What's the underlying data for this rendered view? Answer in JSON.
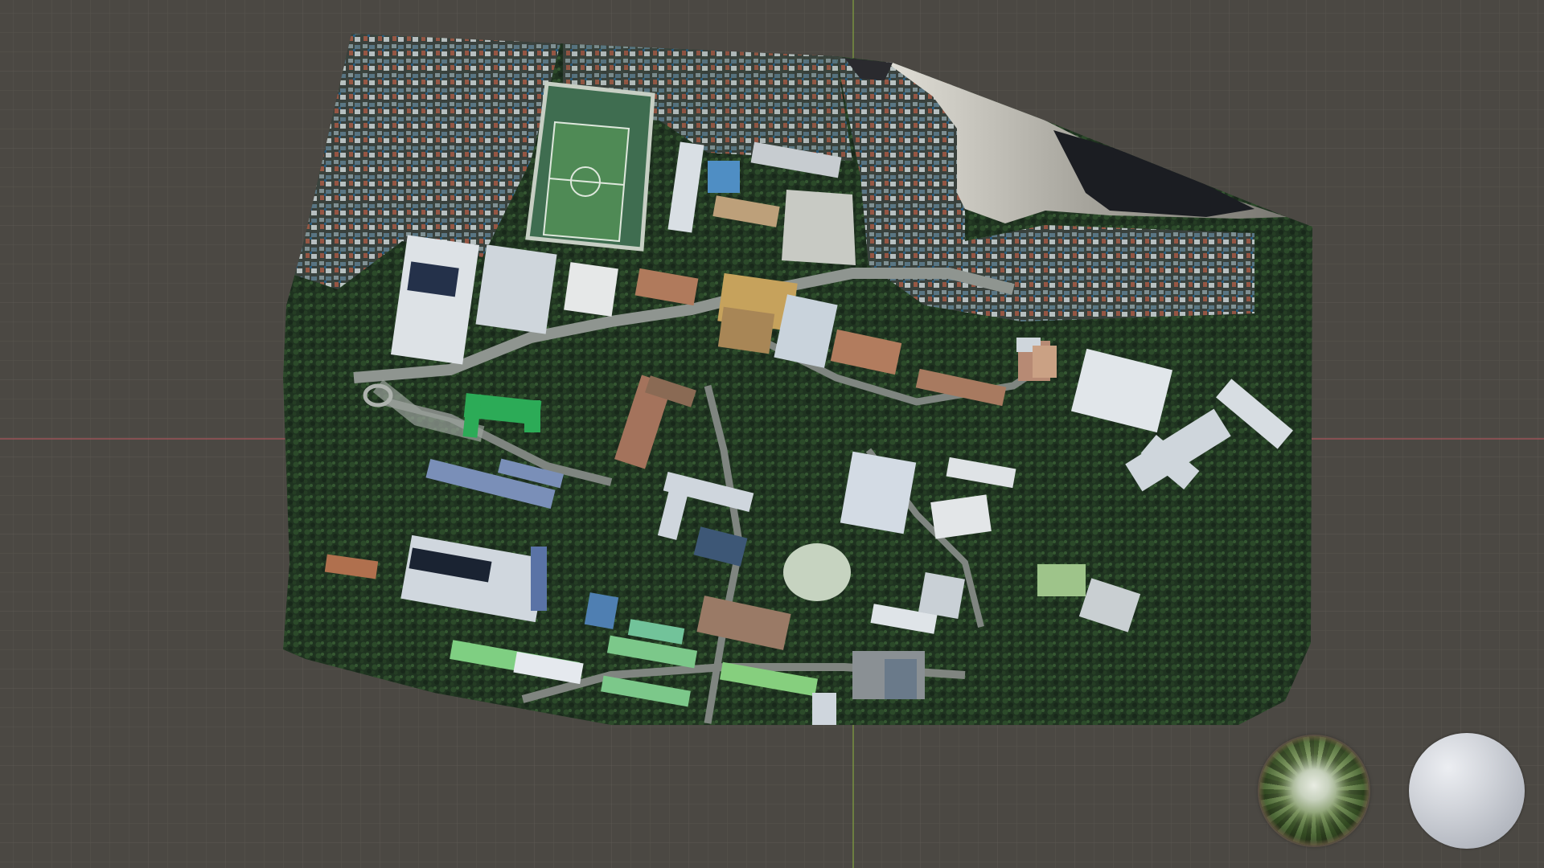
{
  "viewport": {
    "background_color": "#4b4843",
    "grid_color": "#58554f",
    "x_axis_color": "#a8545c",
    "y_axis_color": "#7f9b3e"
  },
  "scene": {
    "map_mesh": "campus-aerial-photogrammetry-mesh",
    "hdri_preview": "hdri-environment-sphere",
    "material_preview": "matte-material-sphere"
  }
}
